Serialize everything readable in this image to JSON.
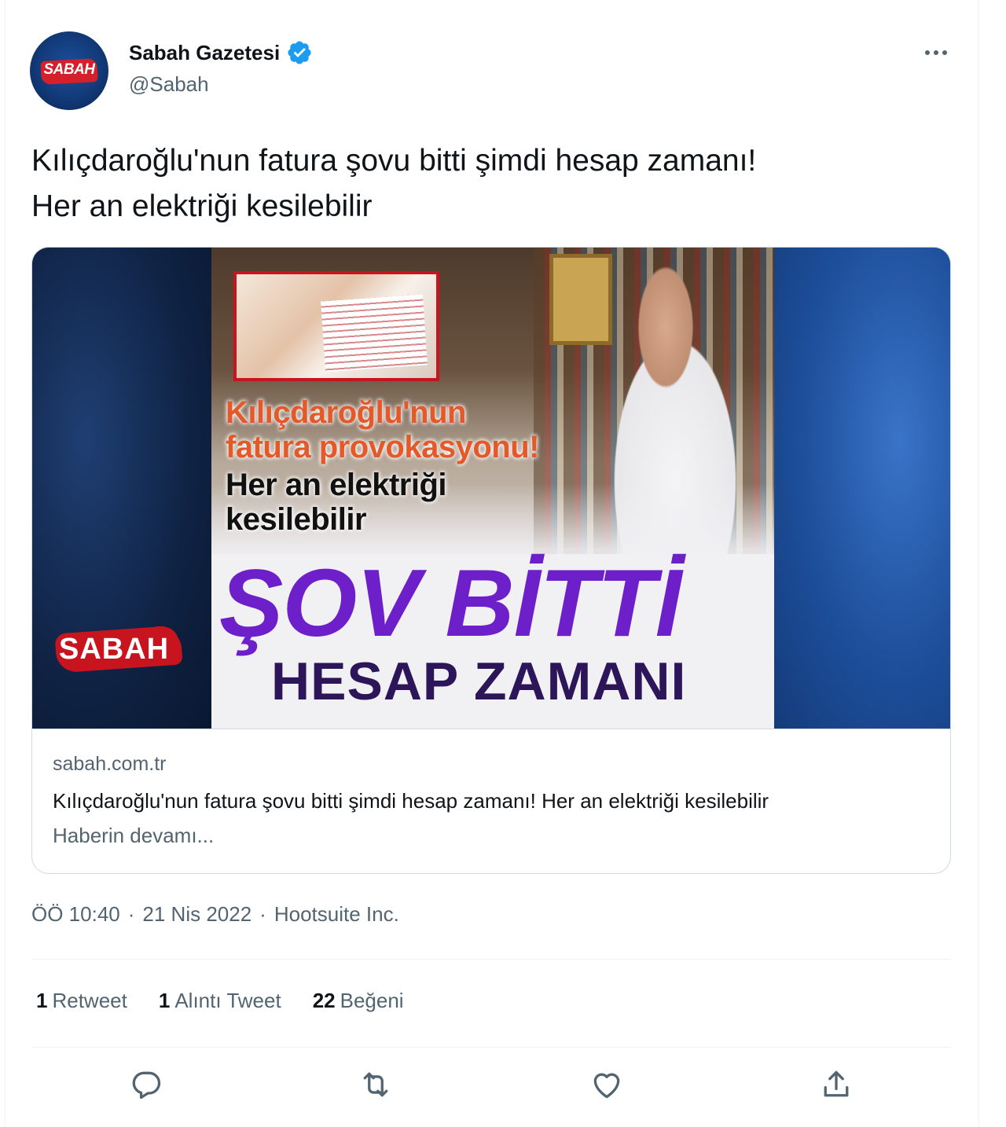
{
  "account": {
    "display_name": "Sabah Gazetesi",
    "handle": "@Sabah",
    "avatar_logo_text": "SABAH",
    "verified": true,
    "verified_color": "#1d9bf0"
  },
  "tweet": {
    "text": "Kılıçdaroğlu'nun fatura şovu bitti şimdi hesap zamanı!\nHer an elektriği kesilebilir"
  },
  "card": {
    "image": {
      "headline_orange": "Kılıçdaroğlu'nun\nfatura provokasyonu!",
      "headline_black": "Her an elektriği\nkesilebilir",
      "big_purple": "ŞOV BİTTİ",
      "big_dark": "HESAP ZAMANI",
      "watermark": "SABAH"
    },
    "domain": "sabah.com.tr",
    "title": "Kılıçdaroğlu'nun fatura şovu bitti şimdi hesap zamanı! Her an elektriği kesilebilir",
    "description": "Haberin devamı..."
  },
  "meta": {
    "time": "ÖÖ 10:40",
    "date": "21 Nis 2022",
    "source": "Hootsuite Inc.",
    "separator": "·"
  },
  "stats": [
    {
      "count": "1",
      "label": "Retweet"
    },
    {
      "count": "1",
      "label": "Alıntı Tweet"
    },
    {
      "count": "22",
      "label": "Beğeni"
    }
  ],
  "actions": {
    "reply_icon": "reply-icon",
    "retweet_icon": "retweet-icon",
    "like_icon": "heart-icon",
    "share_icon": "share-icon"
  },
  "colors": {
    "text_primary": "#0f1419",
    "text_secondary": "#536471",
    "border": "#cfd9de",
    "brand_red": "#c8141f",
    "purple": "#6d1fc9"
  }
}
